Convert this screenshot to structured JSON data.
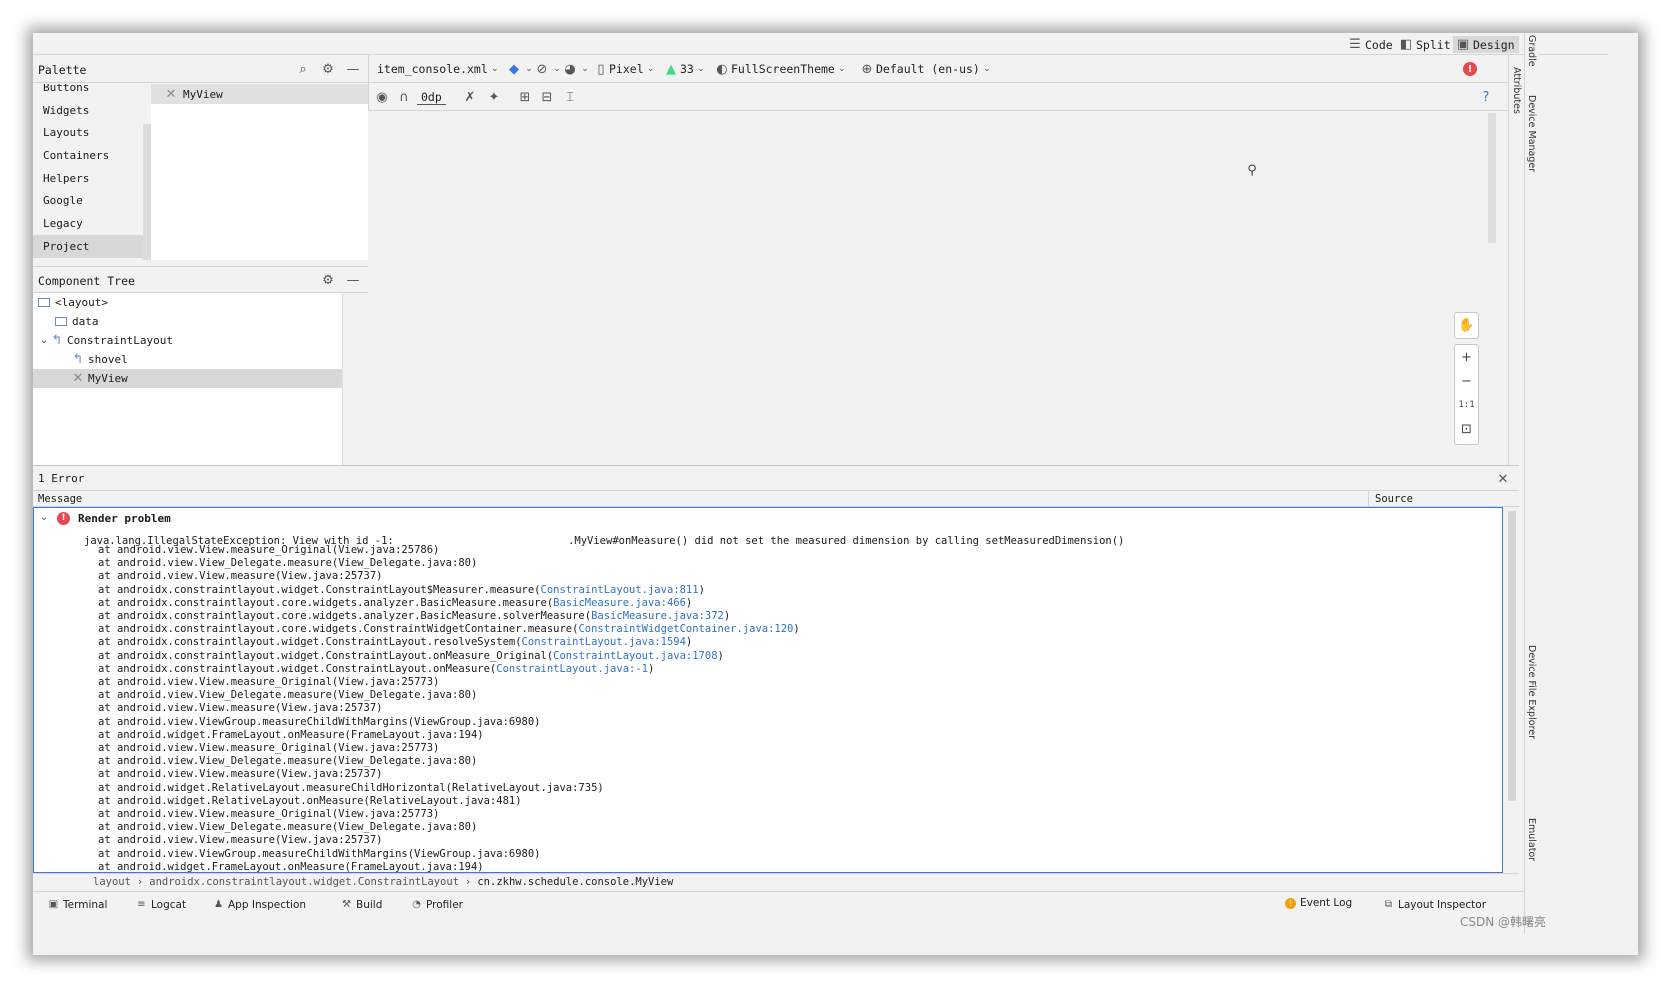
{
  "mode_bar": {
    "code": "Code",
    "split": "Split",
    "design": "Design"
  },
  "palette": {
    "title": "Palette",
    "categories": [
      "Buttons",
      "Widgets",
      "Layouts",
      "Containers",
      "Helpers",
      "Google",
      "Legacy",
      "Project"
    ],
    "selected_category": "Project",
    "items": [
      "MyView"
    ]
  },
  "component_tree": {
    "title": "Component Tree",
    "nodes": [
      "<layout>",
      "data",
      "ConstraintLayout",
      "shovel",
      "MyView"
    ]
  },
  "toolbar": {
    "file": "item_console.xml",
    "device": "Pixel",
    "api": "33",
    "theme": "FullScreenTheme",
    "locale": "Default (en-us)",
    "margin": "0dp"
  },
  "zoom": {
    "reset": "1:1"
  },
  "side_tabs": {
    "gradle": "Gradle",
    "attributes": "Attributes",
    "device_manager": "Device Manager",
    "device_file_explorer": "Device File Explorer",
    "emulator": "Emulator"
  },
  "errors": {
    "count_label": "1 Error",
    "col_message": "Message",
    "col_source": "Source",
    "title": "Render problem",
    "exception_prefix": "java.lang.IllegalStateException: View with id -1: ",
    "exception_suffix": ".MyView#onMeasure() did not set the measured dimension by calling setMeasuredDimension()",
    "stack": [
      {
        "text": "at android.view.View.measure_Original(View.java:25786)"
      },
      {
        "text": "at android.view.View_Delegate.measure(View_Delegate.java:80)"
      },
      {
        "text": "at android.view.View.measure(View.java:25737)"
      },
      {
        "text": "at androidx.constraintlayout.widget.ConstraintLayout$Measurer.measure(",
        "link": "ConstraintLayout.java:811",
        "end": ")"
      },
      {
        "text": "at androidx.constraintlayout.core.widgets.analyzer.BasicMeasure.measure(",
        "link": "BasicMeasure.java:466",
        "end": ")"
      },
      {
        "text": "at androidx.constraintlayout.core.widgets.analyzer.BasicMeasure.solverMeasure(",
        "link": "BasicMeasure.java:372",
        "end": ")"
      },
      {
        "text": "at androidx.constraintlayout.core.widgets.ConstraintWidgetContainer.measure(",
        "link": "ConstraintWidgetContainer.java:120",
        "end": ")"
      },
      {
        "text": "at androidx.constraintlayout.widget.ConstraintLayout.resolveSystem(",
        "link": "ConstraintLayout.java:1594",
        "end": ")"
      },
      {
        "text": "at androidx.constraintlayout.widget.ConstraintLayout.onMeasure_Original(",
        "link": "ConstraintLayout.java:1708",
        "end": ")"
      },
      {
        "text": "at androidx.constraintlayout.widget.ConstraintLayout.onMeasure(",
        "link": "ConstraintLayout.java:-1",
        "end": ")"
      },
      {
        "text": "at android.view.View.measure_Original(View.java:25773)"
      },
      {
        "text": "at android.view.View_Delegate.measure(View_Delegate.java:80)"
      },
      {
        "text": "at android.view.View.measure(View.java:25737)"
      },
      {
        "text": "at android.view.ViewGroup.measureChildWithMargins(ViewGroup.java:6980)"
      },
      {
        "text": "at android.widget.FrameLayout.onMeasure(FrameLayout.java:194)"
      },
      {
        "text": "at android.view.View.measure_Original(View.java:25773)"
      },
      {
        "text": "at android.view.View_Delegate.measure(View_Delegate.java:80)"
      },
      {
        "text": "at android.view.View.measure(View.java:25737)"
      },
      {
        "text": "at android.widget.RelativeLayout.measureChildHorizontal(RelativeLayout.java:735)"
      },
      {
        "text": "at android.widget.RelativeLayout.onMeasure(RelativeLayout.java:481)"
      },
      {
        "text": "at android.view.View.measure_Original(View.java:25773)"
      },
      {
        "text": "at android.view.View_Delegate.measure(View_Delegate.java:80)"
      },
      {
        "text": "at android.view.View.measure(View.java:25737)"
      },
      {
        "text": "at android.view.ViewGroup.measureChildWithMargins(ViewGroup.java:6980)"
      },
      {
        "text": "at android.widget.FrameLayout.onMeasure(FrameLayout.java:194)"
      }
    ]
  },
  "breadcrumb": [
    "layout",
    "androidx.constraintlayout.widget.ConstraintLayout",
    "cn.zkhw.schedule.console.MyView"
  ],
  "status_bar": {
    "terminal": "Terminal",
    "logcat": "Logcat",
    "app_inspection": "App Inspection",
    "build": "Build",
    "profiler": "Profiler",
    "event_log": "Event Log",
    "layout_inspector": "Layout Inspector"
  },
  "watermark": "CSDN @韩曙亮",
  "colors": {
    "error": "#e5484d",
    "link": "#2f71c8",
    "selection": "#d8d8d8",
    "focus": "#3b78d8"
  }
}
